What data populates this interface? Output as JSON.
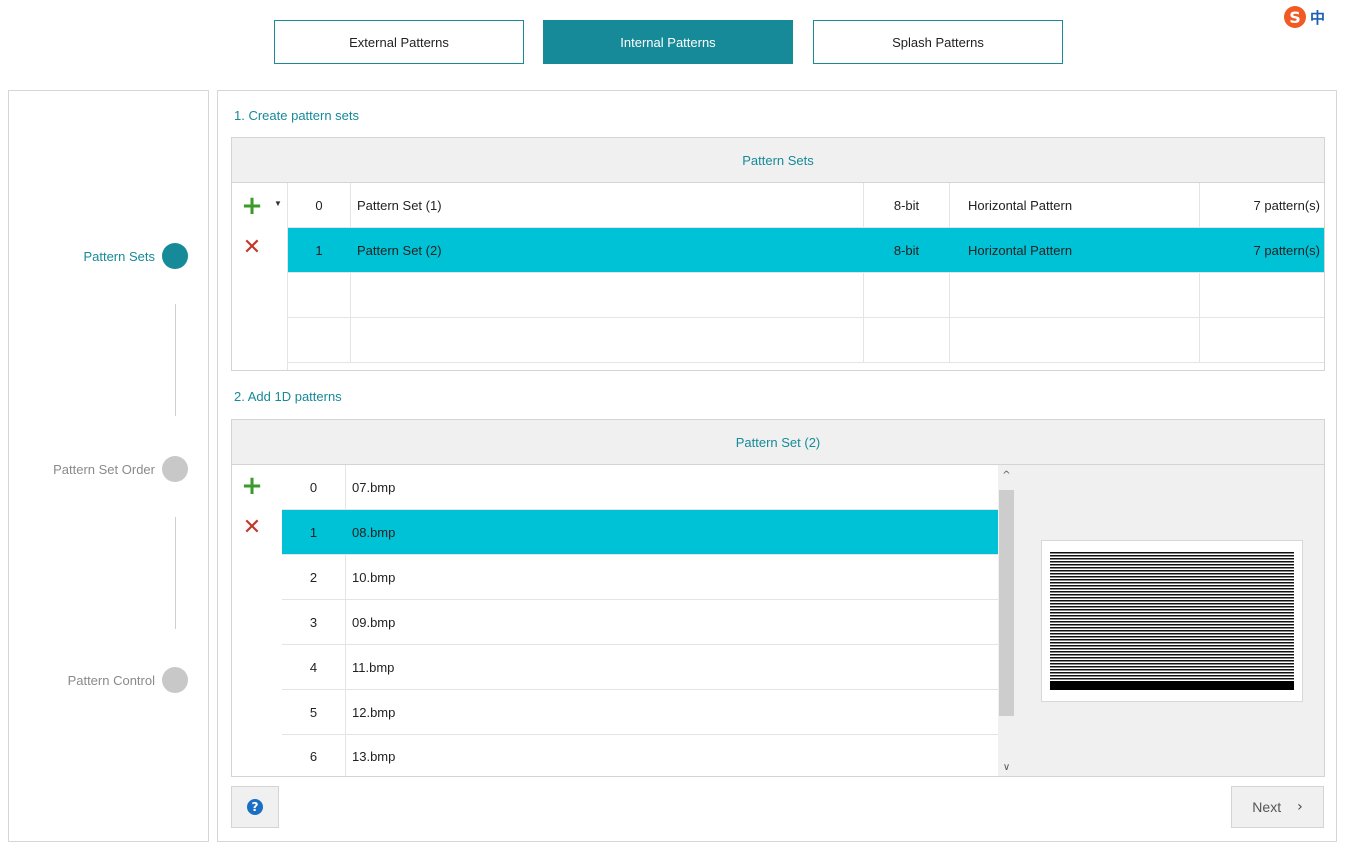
{
  "top_tabs": [
    {
      "label": "External Patterns",
      "active": false
    },
    {
      "label": "Internal Patterns",
      "active": true
    },
    {
      "label": "Splash Patterns",
      "active": false
    }
  ],
  "ime": {
    "logo": "S",
    "lang": "中"
  },
  "steps": [
    {
      "label": "Pattern Sets",
      "state": "active"
    },
    {
      "label": "Pattern Set Order",
      "state": "inactive"
    },
    {
      "label": "Pattern Control",
      "state": "inactive"
    }
  ],
  "section1": {
    "title": "1. Create pattern sets",
    "grid_title": "Pattern Sets",
    "rows": [
      {
        "index": "0",
        "name": "Pattern Set (1)",
        "bit_depth": "8-bit",
        "orientation": "Horizontal Pattern",
        "count": "7 pattern(s)",
        "selected": false
      },
      {
        "index": "1",
        "name": "Pattern Set (2)",
        "bit_depth": "8-bit",
        "orientation": "Horizontal Pattern",
        "count": "7 pattern(s)",
        "selected": true
      }
    ]
  },
  "section2": {
    "title": "2. Add 1D patterns",
    "grid_title": "Pattern Set (2)",
    "rows": [
      {
        "index": "0",
        "file": "07.bmp",
        "selected": false
      },
      {
        "index": "1",
        "file": "08.bmp",
        "selected": true
      },
      {
        "index": "2",
        "file": "10.bmp",
        "selected": false
      },
      {
        "index": "3",
        "file": "09.bmp",
        "selected": false
      },
      {
        "index": "4",
        "file": "11.bmp",
        "selected": false
      },
      {
        "index": "5",
        "file": "12.bmp",
        "selected": false
      },
      {
        "index": "6",
        "file": "13.bmp",
        "selected": false
      }
    ]
  },
  "icons": {
    "add": "plus-icon",
    "remove": "cross-icon",
    "help": "question-icon",
    "next": "chevron-right-icon"
  },
  "colors": {
    "accent": "#168a98",
    "selection": "#00c2d6",
    "add": "#3a9a2a",
    "remove": "#c0392b"
  },
  "footer": {
    "help_glyph": "?",
    "next_label": "Next"
  }
}
